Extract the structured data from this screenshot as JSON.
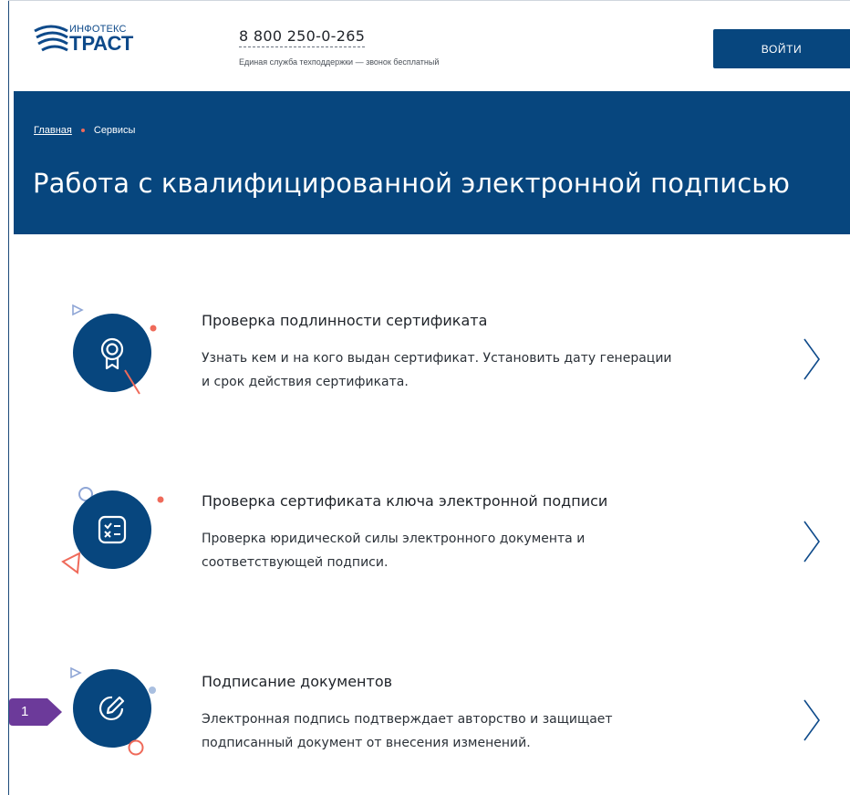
{
  "header": {
    "logo_top": "ИНФОТЕКС",
    "logo_main": "ТРАСТ",
    "phone": "8 800 250-0-265",
    "support_text": "Единая служба техподдержки — звонок бесплатный",
    "login_label": "ВОЙТИ"
  },
  "breadcrumb": {
    "home": "Главная",
    "current": "Сервисы"
  },
  "page_title": "Работа с квалифицированной электронной подписью",
  "services": [
    {
      "title": "Проверка подлинности сертификата",
      "desc_line1": "Узнать кем и на кого выдан сертификат. Установить дату генерации",
      "desc_line2": "и срок действия сертификата.",
      "icon": "certificate-badge-icon"
    },
    {
      "title": "Проверка сертификата ключа электронной подписи",
      "desc_line1": "Проверка юридической силы электронного документа и",
      "desc_line2": "соответствующей подписи.",
      "icon": "checklist-icon"
    },
    {
      "title": "Подписание документов",
      "desc_line1": "Электронная подпись подтверждает авторство и защищает",
      "desc_line2": "подписанный документ от внесения изменений.",
      "icon": "pen-sign-icon"
    }
  ],
  "annotation_badge": "1",
  "colors": {
    "brand": "#07467e",
    "accent": "#ef6a5a",
    "badge": "#6c3a9a"
  }
}
